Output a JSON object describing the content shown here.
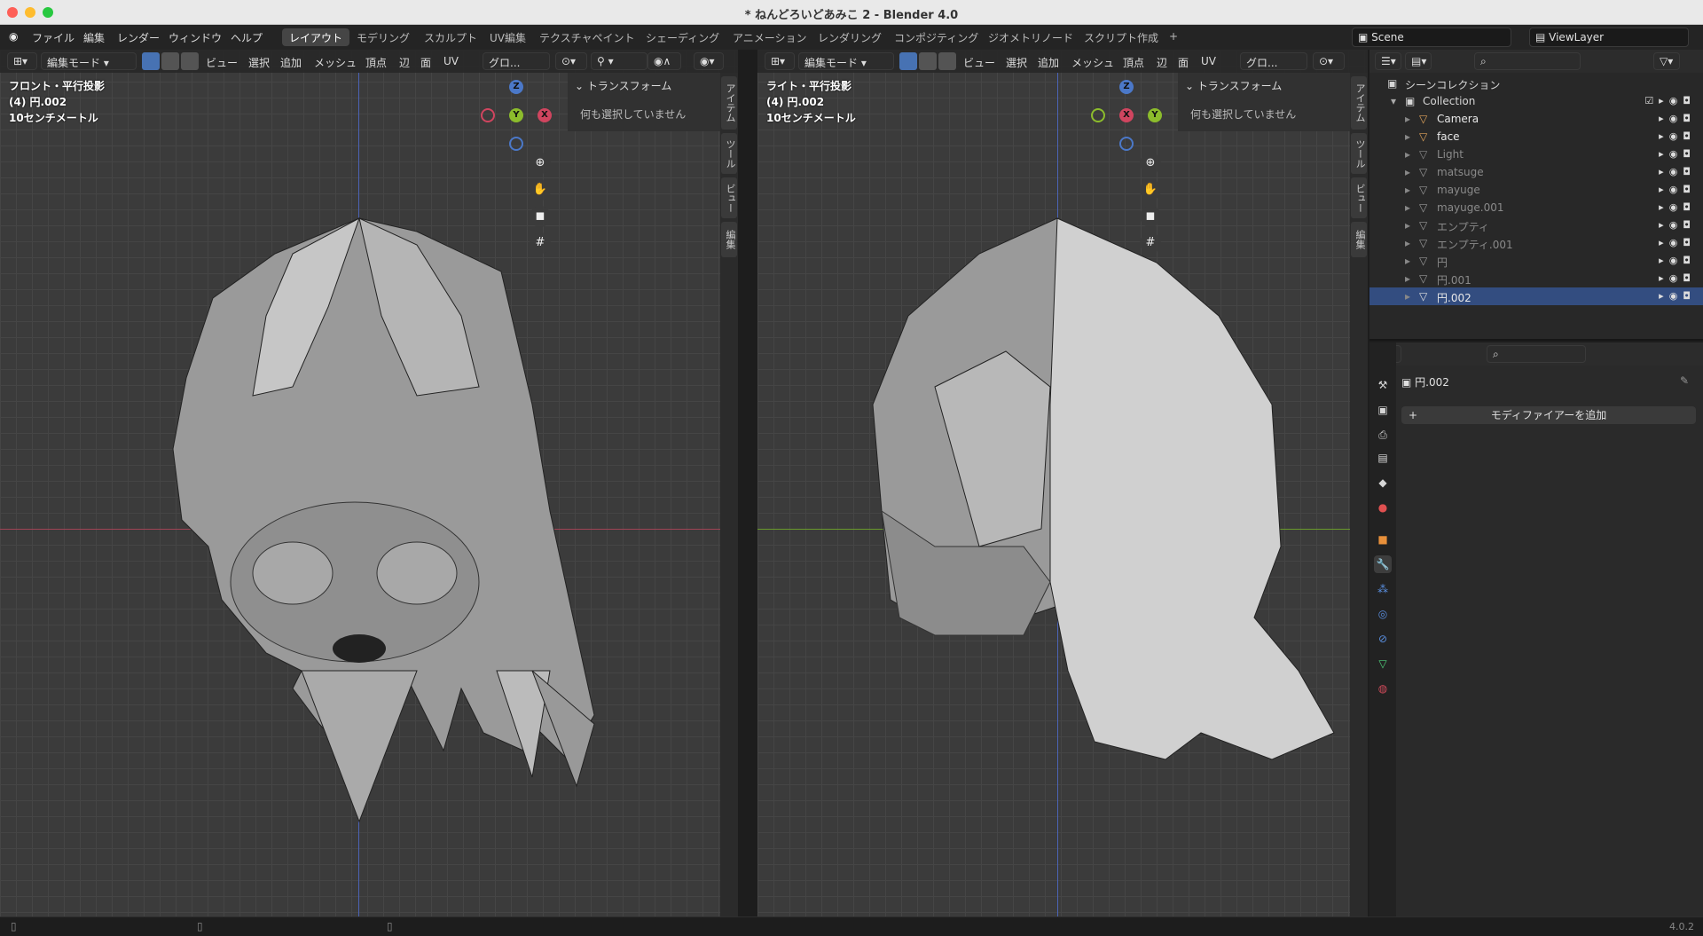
{
  "window": {
    "title": "* ねんどろいどあみこ 2 - Blender 4.0"
  },
  "menu": [
    "ファイル",
    "編集",
    "レンダー",
    "ウィンドウ",
    "ヘルプ"
  ],
  "workspaces": [
    "レイアウト",
    "モデリング",
    "スカルプト",
    "UV編集",
    "テクスチャペイント",
    "シェーディング",
    "アニメーション",
    "レンダリング",
    "コンポジティング",
    "ジオメトリノード",
    "スクリプト作成"
  ],
  "workspace_add": "+",
  "scene": {
    "name": "Scene",
    "view_layer": "ViewLayer"
  },
  "viewport_left": {
    "mode": "編集モード",
    "menus": [
      "ビュー",
      "選択",
      "追加",
      "メッシュ",
      "頂点",
      "辺",
      "面",
      "UV"
    ],
    "orientation": "グロ...",
    "view_name": "フロント・平行投影",
    "object_info": "(4) 円.002",
    "scale_info": "10センチメートル",
    "gizmo": {
      "top": "Z",
      "center": "Y",
      "right": "X"
    },
    "npanel": {
      "title": "トランスフォーム",
      "message": "何も選択していません"
    },
    "side_tabs": [
      "アイテム",
      "ツール",
      "ビュー",
      "編集"
    ]
  },
  "viewport_right": {
    "mode": "編集モード",
    "menus": [
      "ビュー",
      "選択",
      "追加",
      "メッシュ",
      "頂点",
      "辺",
      "面",
      "UV"
    ],
    "orientation": "グロ...",
    "view_name": "ライト・平行投影",
    "object_info": "(4) 円.002",
    "scale_info": "10センチメートル",
    "gizmo": {
      "top": "Z",
      "center": "X",
      "right": "Y"
    },
    "npanel": {
      "title": "トランスフォーム",
      "message": "何も選択していません"
    },
    "side_tabs": [
      "アイテム",
      "ツール",
      "ビュー",
      "編集"
    ]
  },
  "outliner": {
    "root": "シーンコレクション",
    "collection": "Collection",
    "items": [
      {
        "name": "Camera",
        "color": "#e0a35a",
        "active": true
      },
      {
        "name": "face",
        "color": "#e0a35a",
        "active": true
      },
      {
        "name": "Light",
        "color": "#8a8a8a",
        "active": false
      },
      {
        "name": "matsuge",
        "color": "#9a9a9a",
        "active": false
      },
      {
        "name": "mayuge",
        "color": "#9a9a9a",
        "active": false
      },
      {
        "name": "mayuge.001",
        "color": "#9a9a9a",
        "active": false
      },
      {
        "name": "エンプティ",
        "color": "#9a9a9a",
        "active": false
      },
      {
        "name": "エンプティ.001",
        "color": "#9a9a9a",
        "active": false
      },
      {
        "name": "円",
        "color": "#9a9a9a",
        "active": false
      },
      {
        "name": "円.001",
        "color": "#9a9a9a",
        "active": false
      },
      {
        "name": "円.002",
        "color": "#e0e0e0",
        "active": true,
        "selected": true
      }
    ]
  },
  "properties": {
    "object_name": "円.002",
    "add_modifier": "モディファイアーを追加"
  },
  "statusbar": {
    "version": "4.0.2"
  }
}
